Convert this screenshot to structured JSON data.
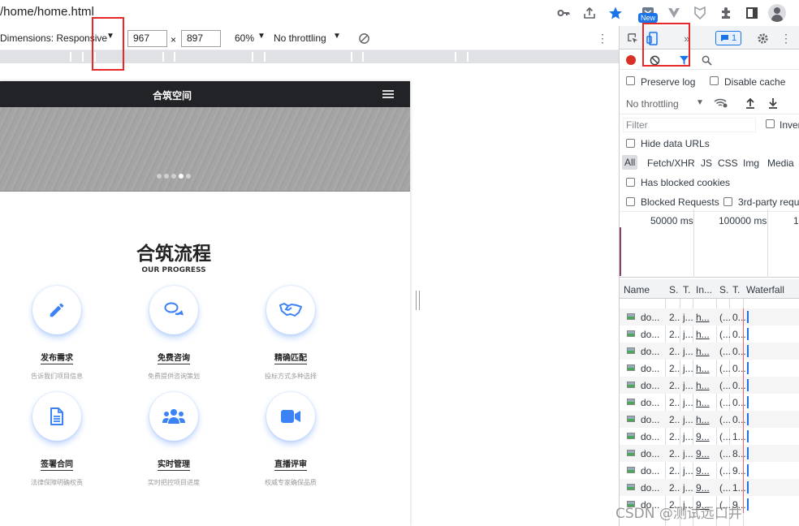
{
  "browser": {
    "url": "/home/home.html",
    "new_badge": "New"
  },
  "device_toolbar": {
    "dimensions_label": "Dimensions: Responsive",
    "width": "967",
    "times": "×",
    "height": "897",
    "zoom": "60%",
    "throttling": "No throttling"
  },
  "page": {
    "nav_title": "合筑空间",
    "section_title": "合筑流程",
    "section_subtitle": "OUR PROGRESS",
    "items": [
      {
        "name": "发布需求",
        "desc": "告诉我们项目信息",
        "icon": "pencil-icon"
      },
      {
        "name": "免费咨询",
        "desc": "免费提供咨询策划",
        "icon": "chat-bubbles-icon"
      },
      {
        "name": "精确匹配",
        "desc": "投标方式多种选择",
        "icon": "handshake-icon"
      },
      {
        "name": "签署合同",
        "desc": "法律保障明确权责",
        "icon": "document-icon"
      },
      {
        "name": "实时管理",
        "desc": "实时把控项目进度",
        "icon": "users-icon"
      },
      {
        "name": "直播评审",
        "desc": "权威专家确保品质",
        "icon": "video-camera-icon"
      }
    ]
  },
  "devtools": {
    "issues_count": "1",
    "preserve_log": "Preserve log",
    "disable_cache": "Disable cache",
    "throttling": "No throttling",
    "filter_placeholder": "Filter",
    "invert": "Inver",
    "hide_data_urls": "Hide data URLs",
    "types": [
      "All",
      "Fetch/XHR",
      "JS",
      "CSS",
      "Img",
      "Media"
    ],
    "has_blocked_cookies": "Has blocked cookies",
    "blocked_requests": "Blocked Requests",
    "third_party": "3rd-party requ",
    "timeline": [
      "50000 ms",
      "100000 ms",
      "1"
    ],
    "columns": [
      "Name",
      "S.",
      "T.",
      "In...",
      "S.",
      "T.",
      "Waterfall"
    ],
    "rows": [
      {
        "name": "do...",
        "s": "2..",
        "t": "j...",
        "i": "h...",
        "s2": "(...",
        "t2": "0..."
      },
      {
        "name": "do...",
        "s": "2..",
        "t": "j...",
        "i": "h...",
        "s2": "(...",
        "t2": "0..."
      },
      {
        "name": "do...",
        "s": "2..",
        "t": "j...",
        "i": "h...",
        "s2": "(...",
        "t2": "0..."
      },
      {
        "name": "do...",
        "s": "2..",
        "t": "j...",
        "i": "h...",
        "s2": "(...",
        "t2": "0..."
      },
      {
        "name": "do...",
        "s": "2..",
        "t": "j...",
        "i": "h...",
        "s2": "(...",
        "t2": "0..."
      },
      {
        "name": "do...",
        "s": "2..",
        "t": "j...",
        "i": "h...",
        "s2": "(...",
        "t2": "0..."
      },
      {
        "name": "do...",
        "s": "2..",
        "t": "j...",
        "i": "h...",
        "s2": "(...",
        "t2": "0..."
      },
      {
        "name": "do...",
        "s": "2..",
        "t": "j...",
        "i": "9...",
        "s2": "(...",
        "t2": "1..."
      },
      {
        "name": "do...",
        "s": "2..",
        "t": "j...",
        "i": "9...",
        "s2": "(...",
        "t2": "8..."
      },
      {
        "name": "do...",
        "s": "2..",
        "t": "j...",
        "i": "9...",
        "s2": "(...",
        "t2": "9..."
      },
      {
        "name": "do...",
        "s": "2..",
        "t": "j...",
        "i": "9...",
        "s2": "(...",
        "t2": "1..."
      },
      {
        "name": "do...",
        "s": "2..",
        "t": "j...",
        "i": "9...",
        "s2": "(...",
        "t2": "9..."
      }
    ]
  },
  "watermark": "CSDN @测试远口井"
}
